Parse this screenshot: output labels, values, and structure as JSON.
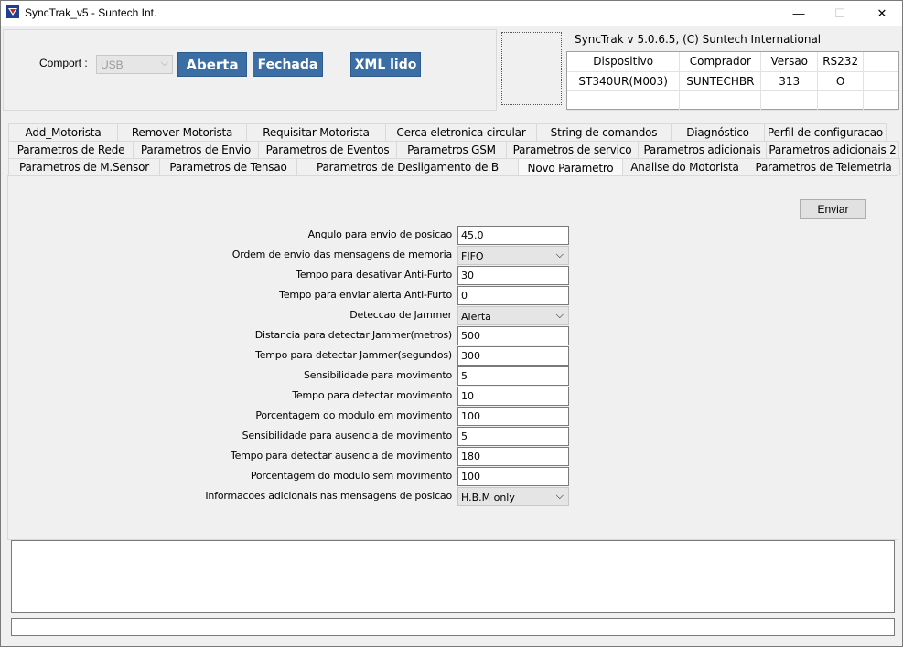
{
  "window": {
    "title": "SyncTrak_v5 - Suntech Int.",
    "minimize": "—",
    "maximize": "☐",
    "close": "✕"
  },
  "connection": {
    "comport_label": "Comport :",
    "comport_value": "USB",
    "open_button": "Aberta",
    "close_button": "Fechada",
    "xml_button": "XML lido"
  },
  "device_info": {
    "version": "SyncTrak v 5.0.6.5, (C) Suntech International",
    "headers": [
      "Dispositivo",
      "Comprador",
      "Versao",
      "RS232"
    ],
    "values": [
      "ST340UR(M003)",
      "SUNTECHBR",
      "313",
      "O"
    ]
  },
  "tabs": {
    "row1": [
      "Add_Motorista",
      "Remover Motorista",
      "Requisitar Motorista",
      "Cerca eletronica circular",
      "String de comandos",
      "Diagnóstico",
      "Perfil de configuracao"
    ],
    "row2": [
      "Parametros de Rede",
      "Parametros de Envio",
      "Parametros de Eventos",
      "Parametros GSM",
      "Parametros de servico",
      "Parametros adicionais",
      "Parametros adicionais 2"
    ],
    "row3": [
      "Parametros  de M.Sensor",
      "Parametros de Tensao",
      "Parametros de Desligamento de B",
      "Novo Parametro",
      "Analise do Motorista",
      "Parametros de Telemetria"
    ],
    "active": "Novo Parametro"
  },
  "panel": {
    "send_button": "Enviar",
    "fields": [
      {
        "label": "Angulo para envio de posicao",
        "value": "45.0",
        "type": "input"
      },
      {
        "label": "Ordem de envio das mensagens de memoria",
        "value": "FIFO",
        "type": "select"
      },
      {
        "label": "Tempo para desativar Anti-Furto",
        "value": "30",
        "type": "input"
      },
      {
        "label": "Tempo para enviar alerta Anti-Furto",
        "value": "0",
        "type": "input"
      },
      {
        "label": "Deteccao de Jammer",
        "value": "Alerta",
        "type": "select"
      },
      {
        "label": "Distancia para detectar Jammer(metros)",
        "value": "500",
        "type": "input"
      },
      {
        "label": "Tempo para detectar Jammer(segundos)",
        "value": "300",
        "type": "input"
      },
      {
        "label": "Sensibilidade para movimento",
        "value": "5",
        "type": "input"
      },
      {
        "label": "Tempo para detectar movimento",
        "value": "10",
        "type": "input"
      },
      {
        "label": "Porcentagem do modulo em movimento",
        "value": "100",
        "type": "input"
      },
      {
        "label": "Sensibilidade para ausencia de movimento",
        "value": "5",
        "type": "input"
      },
      {
        "label": "Tempo para detectar ausencia de movimento",
        "value": "180",
        "type": "input"
      },
      {
        "label": "Porcentagem do modulo sem movimento",
        "value": "100",
        "type": "input"
      },
      {
        "label": "Informacoes adicionais nas mensagens de posicao",
        "value": "H.B.M only",
        "type": "select"
      }
    ]
  },
  "icons": {
    "dropdown": "chevron-down-icon",
    "app": "app-logo-icon"
  }
}
